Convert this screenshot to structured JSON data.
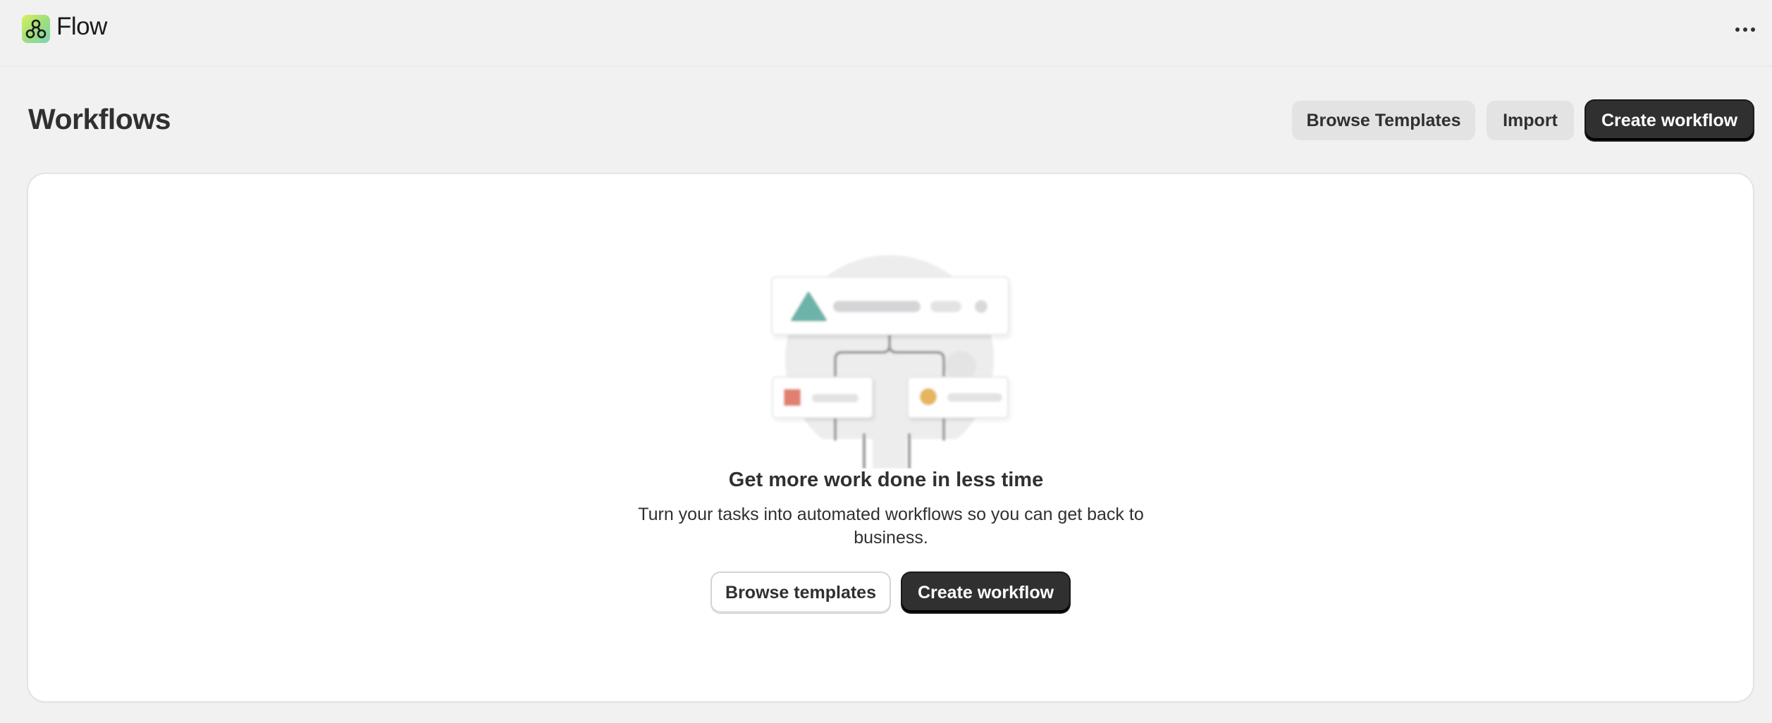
{
  "app": {
    "name": "Flow",
    "logo_icon": "flow-logo-icon",
    "menu_icon": "more-horizontal-icon"
  },
  "page": {
    "title": "Workflows",
    "actions": {
      "browse_templates": "Browse Templates",
      "import": "Import",
      "create_workflow": "Create workflow"
    }
  },
  "empty_state": {
    "heading": "Get more work done in less time",
    "body": "Turn your tasks into automated workflows so you can get back to business.",
    "browse_templates": "Browse templates",
    "create_workflow": "Create workflow",
    "illustration_icon": "workflow-diagram-illustration"
  },
  "colors": {
    "background": "#f1f1f1",
    "card": "#ffffff",
    "primary_button": "#303030",
    "secondary_button": "#e3e3e3",
    "illustration_teal": "#6db3a9",
    "illustration_red": "#e0806f",
    "illustration_yellow": "#e5b65b"
  }
}
